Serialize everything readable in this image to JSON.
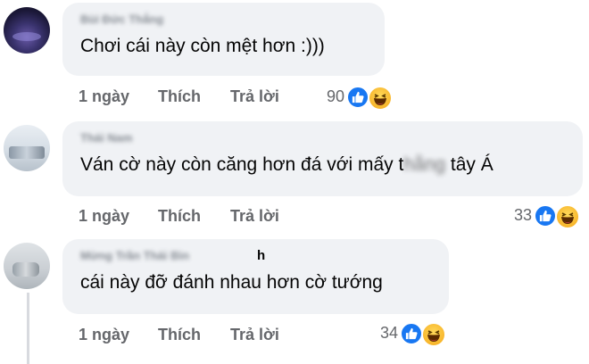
{
  "comments": [
    {
      "author": "Bùi Đức Thắng",
      "text": "Chơi cái này còn mệt hơn :)))",
      "time": "1 ngày",
      "like": "Thích",
      "reply": "Trả lời",
      "count": "90"
    },
    {
      "author": "Thái Nam",
      "text_before": "Ván cờ này còn căng hơn đá với mấy t",
      "text_blurred": "hằng",
      "text_after": " tây Á",
      "time": "1 ngày",
      "like": "Thích",
      "reply": "Trả lời",
      "count": "33"
    },
    {
      "author": "Mừng Trần Thái Bìn",
      "author_tail": "h",
      "text": "cái này đỡ đánh nhau hơn cờ tướng",
      "time": "1 ngày",
      "like": "Thích",
      "reply": "Trả lời",
      "count": "34"
    }
  ],
  "icons": [
    "like-reaction-icon",
    "haha-reaction-icon"
  ],
  "colors": {
    "bubble": "#f0f2f5",
    "meta": "#65676b",
    "like_blue": "#1877f2",
    "haha_yellow": "#f7b125"
  }
}
